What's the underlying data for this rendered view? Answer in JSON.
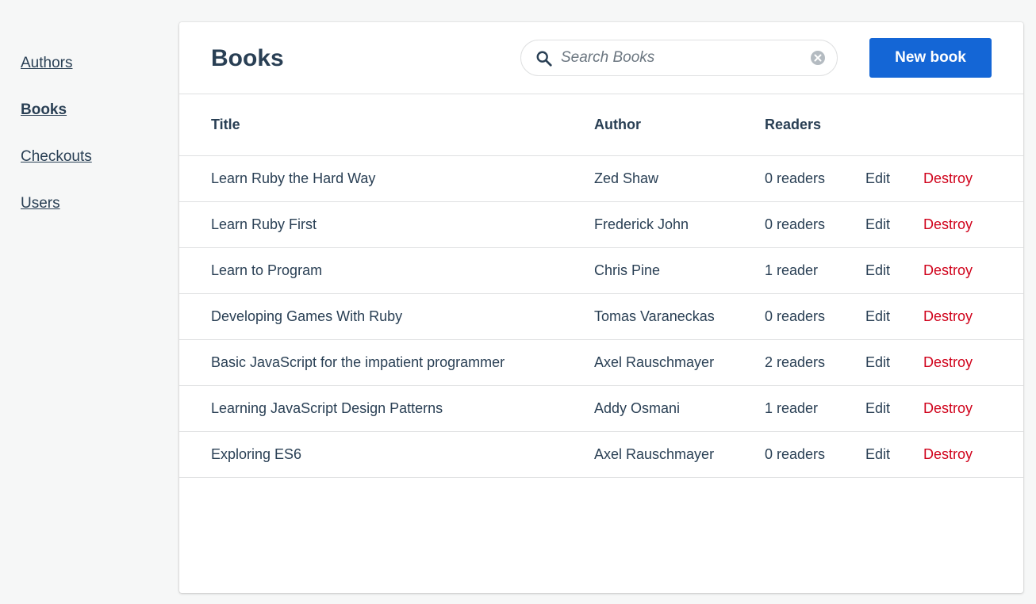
{
  "sidebar": {
    "items": [
      {
        "label": "Authors"
      },
      {
        "label": "Books"
      },
      {
        "label": "Checkouts"
      },
      {
        "label": "Users"
      }
    ]
  },
  "header": {
    "title": "Books",
    "search": {
      "value": "",
      "placeholder": "Search Books"
    },
    "new_button_label": "New book"
  },
  "table": {
    "columns": [
      "Title",
      "Author",
      "Readers"
    ],
    "rows": [
      {
        "title": "Learn Ruby the Hard Way",
        "author": "Zed Shaw",
        "readers": "0 readers",
        "edit": "Edit",
        "destroy": "Destroy"
      },
      {
        "title": "Learn Ruby First",
        "author": "Frederick John",
        "readers": "0 readers",
        "edit": "Edit",
        "destroy": "Destroy"
      },
      {
        "title": "Learn to Program",
        "author": "Chris Pine",
        "readers": "1 reader",
        "edit": "Edit",
        "destroy": "Destroy"
      },
      {
        "title": "Developing Games With Ruby",
        "author": "Tomas Varaneckas",
        "readers": "0 readers",
        "edit": "Edit",
        "destroy": "Destroy"
      },
      {
        "title": "Basic JavaScript for the impatient programmer",
        "author": "Axel Rauschmayer",
        "readers": "2 readers",
        "edit": "Edit",
        "destroy": "Destroy"
      },
      {
        "title": "Learning JavaScript Design Patterns",
        "author": "Addy Osmani",
        "readers": "1 reader",
        "edit": "Edit",
        "destroy": "Destroy"
      },
      {
        "title": "Exploring ES6",
        "author": "Axel Rauschmayer",
        "readers": "0 readers",
        "edit": "Edit",
        "destroy": "Destroy"
      }
    ]
  },
  "colors": {
    "text": "#293f54",
    "accent": "#1466d6",
    "danger": "#d0021b",
    "background": "#f6f7f7"
  },
  "icons": {
    "search": "search-icon",
    "clear": "clear-icon"
  }
}
